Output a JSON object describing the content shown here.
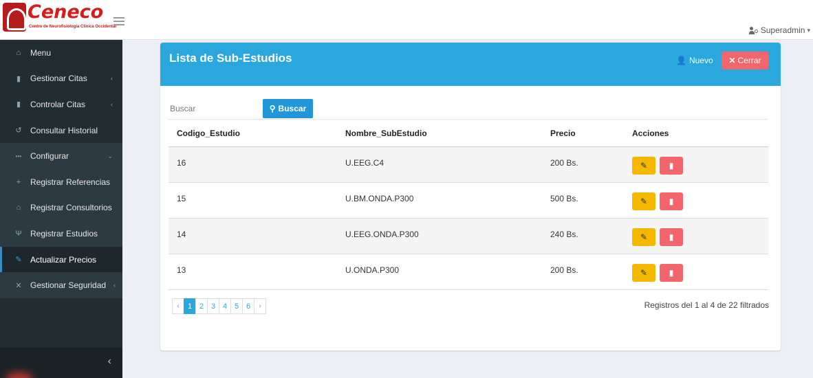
{
  "header": {
    "logo_text": "Ceneco",
    "logo_subtitle": "Centro de Neurofisiología Clínica Occidental",
    "user_name": "Superadmin",
    "user_caret": "▾"
  },
  "sidebar": {
    "items": [
      {
        "label": "Menu",
        "icon": "home-icon",
        "glyph": "⌂",
        "chevron": ""
      },
      {
        "label": "Gestionar Citas",
        "icon": "clipboard-icon",
        "glyph": "▮",
        "chevron": "‹"
      },
      {
        "label": "Controlar Citas",
        "icon": "clipboard-icon",
        "glyph": "▮",
        "chevron": "‹"
      },
      {
        "label": "Consultar Historial",
        "icon": "history-icon",
        "glyph": "↺",
        "chevron": ""
      },
      {
        "label": "Configurar",
        "icon": "dots-icon",
        "glyph": "•••",
        "chevron": "⌄"
      },
      {
        "label": "Registrar Referencias",
        "icon": "user-plus-icon",
        "glyph": "+",
        "chevron": ""
      },
      {
        "label": "Registrar Consultorios",
        "icon": "home-icon",
        "glyph": "⌂",
        "chevron": ""
      },
      {
        "label": "Registrar Estudios",
        "icon": "stethoscope-icon",
        "glyph": "Ψ",
        "chevron": ""
      },
      {
        "label": "Actualizar Precios",
        "icon": "edit-icon",
        "glyph": "✎",
        "chevron": ""
      },
      {
        "label": "Gestionar Seguridad",
        "icon": "tools-icon",
        "glyph": "✕",
        "chevron": "‹"
      }
    ],
    "collapse_glyph": "‹"
  },
  "card": {
    "title": "Lista de Sub-Estudios",
    "new_label": "Nuevo",
    "close_label": "Cerrar",
    "search_placeholder": "Buscar",
    "search_button": "Buscar",
    "columns": [
      "Codigo_Estudio",
      "Nombre_SubEstudio",
      "Precio",
      "Acciones"
    ],
    "rows": [
      {
        "codigo": "16",
        "nombre": "U.EEG.C4",
        "precio": "200 Bs."
      },
      {
        "codigo": "15",
        "nombre": "U.BM.ONDA.P300",
        "precio": "500 Bs."
      },
      {
        "codigo": "14",
        "nombre": "U.EEG.ONDA.P300",
        "precio": "240 Bs."
      },
      {
        "codigo": "13",
        "nombre": "U.ONDA.P300",
        "precio": "200 Bs."
      }
    ],
    "pagination": {
      "prev": "‹",
      "pages": [
        "1",
        "2",
        "3",
        "4",
        "5",
        "6"
      ],
      "next": "›",
      "current": "1"
    },
    "records_text": "Registros del 1 al 4 de 22 filtrados"
  },
  "colors": {
    "header_blue": "#2aa7dc",
    "sidebar_bg": "#222d32",
    "edit_yellow": "#f5b800",
    "delete_red": "#f2666b"
  }
}
